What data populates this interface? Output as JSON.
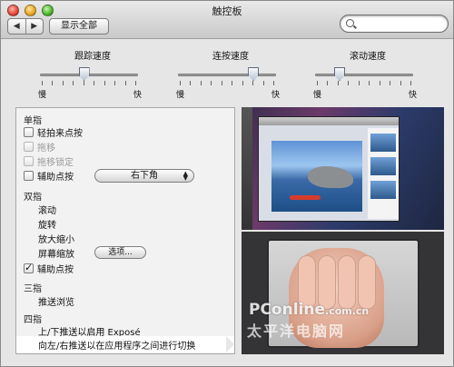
{
  "window": {
    "title": "触控板"
  },
  "toolbar": {
    "back_icon": "◀",
    "forward_icon": "▶",
    "show_all_label": "显示全部",
    "search_placeholder": ""
  },
  "sliders": [
    {
      "label": "跟踪速度",
      "slow": "慢",
      "fast": "快",
      "value_fraction": 0.45
    },
    {
      "label": "连按速度",
      "slow": "慢",
      "fast": "快",
      "value_fraction": 0.77
    },
    {
      "label": "滚动速度",
      "slow": "慢",
      "fast": "快",
      "value_fraction": 0.25
    }
  ],
  "gestures": {
    "one_finger": {
      "title": "单指",
      "tap_to_click": {
        "label": "轻拍来点按",
        "checked": false
      },
      "dragging": {
        "label": "拖移",
        "checked": false,
        "enabled": false
      },
      "drag_lock": {
        "label": "拖移锁定",
        "checked": false,
        "enabled": false
      },
      "secondary_click": {
        "label": "辅助点按",
        "checked": false,
        "popup_value": "右下角"
      }
    },
    "two_fingers": {
      "title": "双指",
      "scroll": "滚动",
      "rotate": "旋转",
      "zoom": "放大缩小",
      "screen_zoom": "屏幕缩放",
      "options_button": "选项...",
      "secondary_click": {
        "label": "辅助点按",
        "checked": true
      }
    },
    "three_fingers": {
      "title": "三指",
      "swipe": "推送浏览"
    },
    "four_fingers": {
      "title": "四指",
      "expose": "上/下推送以启用 Exposé",
      "switch_apps": "向左/右推送以在应用程序之间进行切换"
    }
  },
  "watermark": {
    "line1": "PConline",
    "line1_suffix": ".com.cn",
    "line2": "太平洋电脑网"
  },
  "colors": {
    "window_bg": "#e6e6e6",
    "panel_bg": "#f2f2f2",
    "selected_row": "#ffffff"
  }
}
